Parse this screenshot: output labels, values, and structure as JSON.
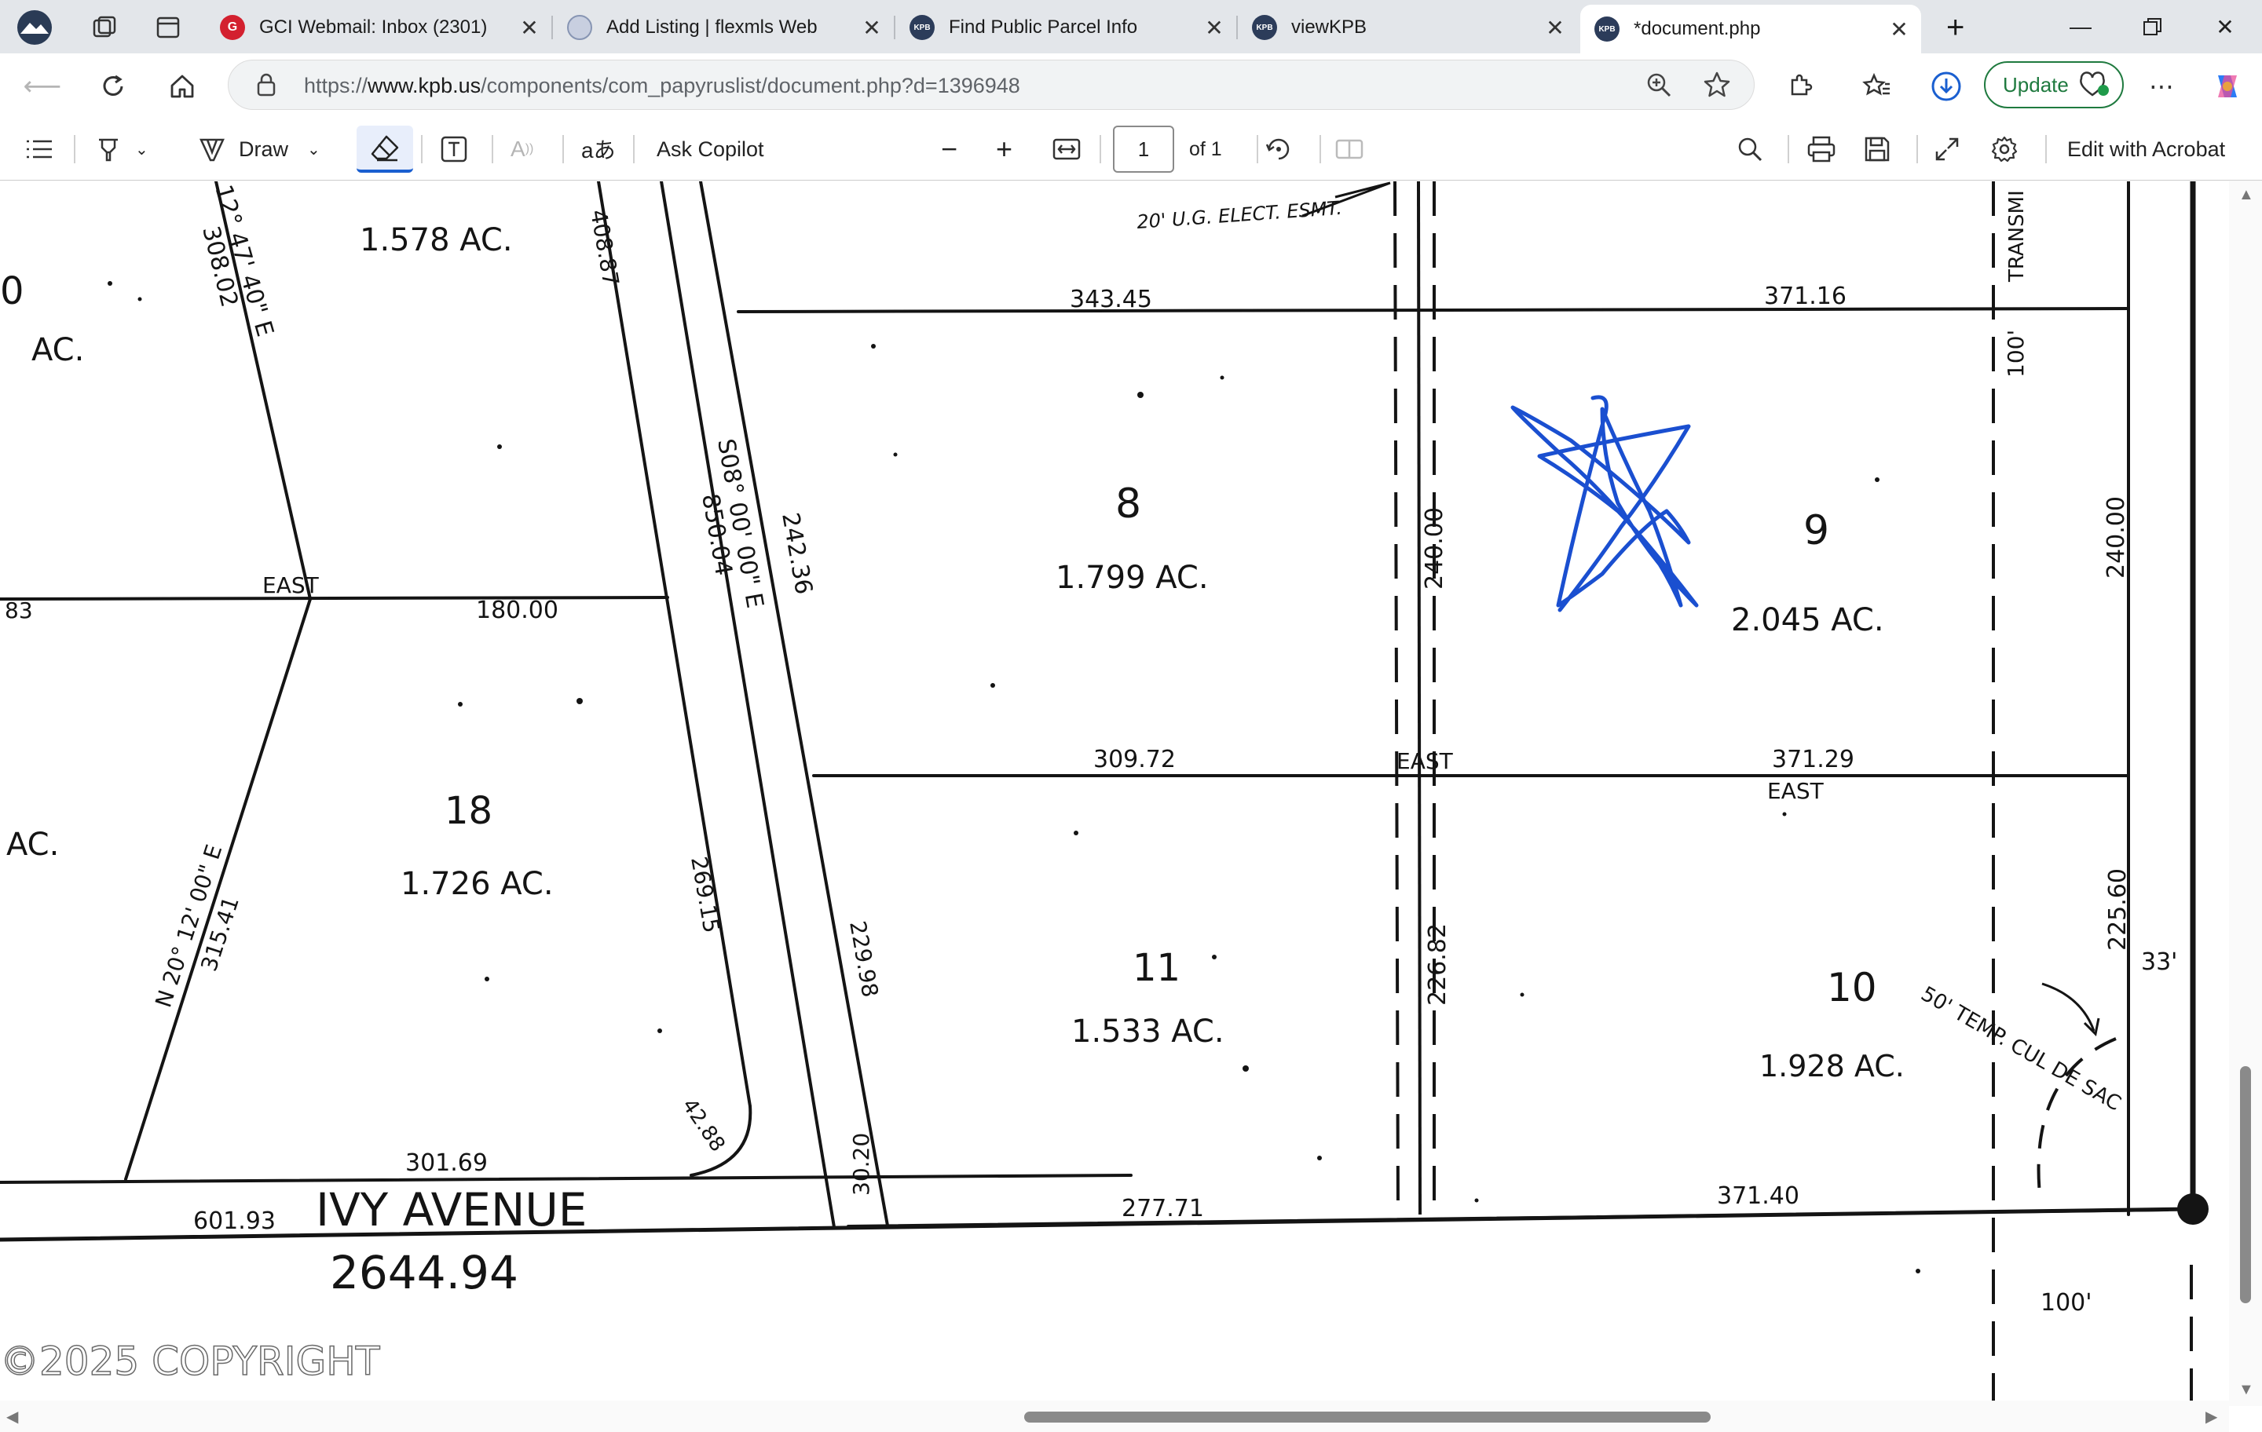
{
  "tabs": [
    {
      "title": "GCI Webmail: Inbox (2301)",
      "favicon": "G"
    },
    {
      "title": "Add Listing | flexmls Web",
      "favicon": ""
    },
    {
      "title": "Find Public Parcel Info",
      "favicon": "KPB"
    },
    {
      "title": "viewKPB",
      "favicon": "KPB"
    },
    {
      "title": "*document.php",
      "favicon": "KPB"
    }
  ],
  "address": {
    "prefix": "https://",
    "host": "www.kpb.us",
    "path": "/components/com_papyruslist/document.php?d=1396948",
    "update_label": "Update"
  },
  "toolbar": {
    "draw_label": "Draw",
    "copilot_label": "Ask Copilot",
    "page_value": "1",
    "page_total": "of 1",
    "acrobat_label": "Edit with Acrobat"
  },
  "plat": {
    "street_name": "IVY   AVENUE",
    "total_length": "2644.94",
    "street_frontage_left": "601.93",
    "copyright": "©2025 COPYRIGHT",
    "easement": "20' U.G. ELECT. ESMT.",
    "transmission": "TRANSMI",
    "cul_de_sac": "50' TEMP. CUL DE SAC",
    "row_width": "100'",
    "row_width_bottom": "100'",
    "half_row": "33'",
    "east_labels": [
      "EAST",
      "EAST",
      "EAST"
    ],
    "lots": [
      {
        "number": "",
        "acres": "1.578 AC."
      },
      {
        "number": "8",
        "acres": "1.799  AC."
      },
      {
        "number": "9",
        "acres": "2.045  AC."
      },
      {
        "number": "18",
        "acres": "1.726  AC."
      },
      {
        "number": "11",
        "acres": "1.533  AC."
      },
      {
        "number": "10",
        "acres": "1.928  AC."
      }
    ],
    "partial_left": [
      "AC.",
      "AC.",
      "0",
      "83"
    ],
    "bearings": [
      "12° 47' 40\" E",
      "S08° 00' 00\" E",
      "N 20° 12' 00\" E"
    ],
    "dimensions": {
      "d343": "343.45",
      "d37116": "371.16",
      "d30802": "308.02",
      "d40887": "408.87",
      "d85004": "850.04",
      "d24236": "242.36",
      "d18000": "180.00",
      "d24000a": "240.00",
      "d24000b": "240.00",
      "d30972": "309.72",
      "d37129": "371.29",
      "d26915": "269.15",
      "d22998": "229.98",
      "d31541": "315.41",
      "d22682": "226.82",
      "d22560": "225.60",
      "d4288": "42.88",
      "d30169": "301.69",
      "d3020": "30.20",
      "d27771": "277.71",
      "d37140": "371.40"
    }
  }
}
